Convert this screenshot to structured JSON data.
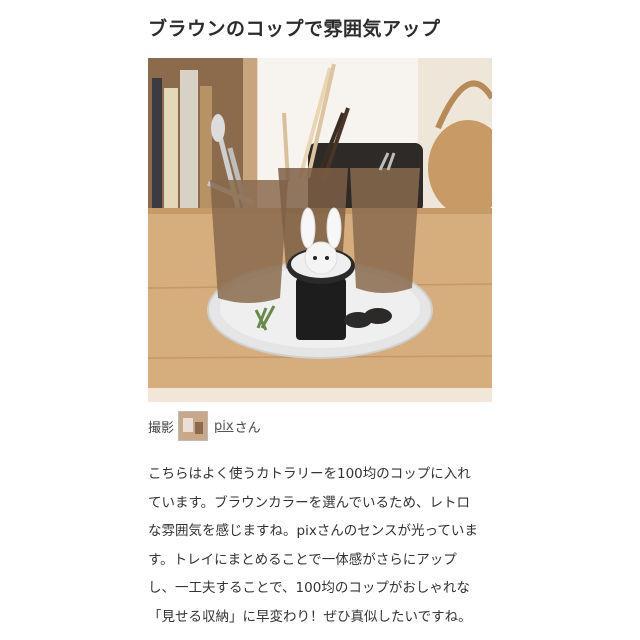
{
  "article": {
    "heading": "ブラウンのコップで雰囲気アップ",
    "credit": {
      "label": "撮影",
      "user": "pix",
      "suffix": "さん"
    },
    "body_lines": [
      "こちらはよく使うカトラリーを100均のコップに入れ",
      "ています。ブラウンカラーを選んでいるため、レトロ",
      "な雰囲気を感じますね。pixさんのセンスが光っていま",
      "す。トレイにまとめることで一体感がさらにアップ",
      "し、一工夫することで、100均のコップがおしゃれな",
      "「見せる収納」に早変わり！ぜひ真似したいですね。"
    ]
  },
  "colors": {
    "wood": "#d9b48a",
    "glass": "#8a6a4e",
    "tray": "#e4e4e4"
  }
}
